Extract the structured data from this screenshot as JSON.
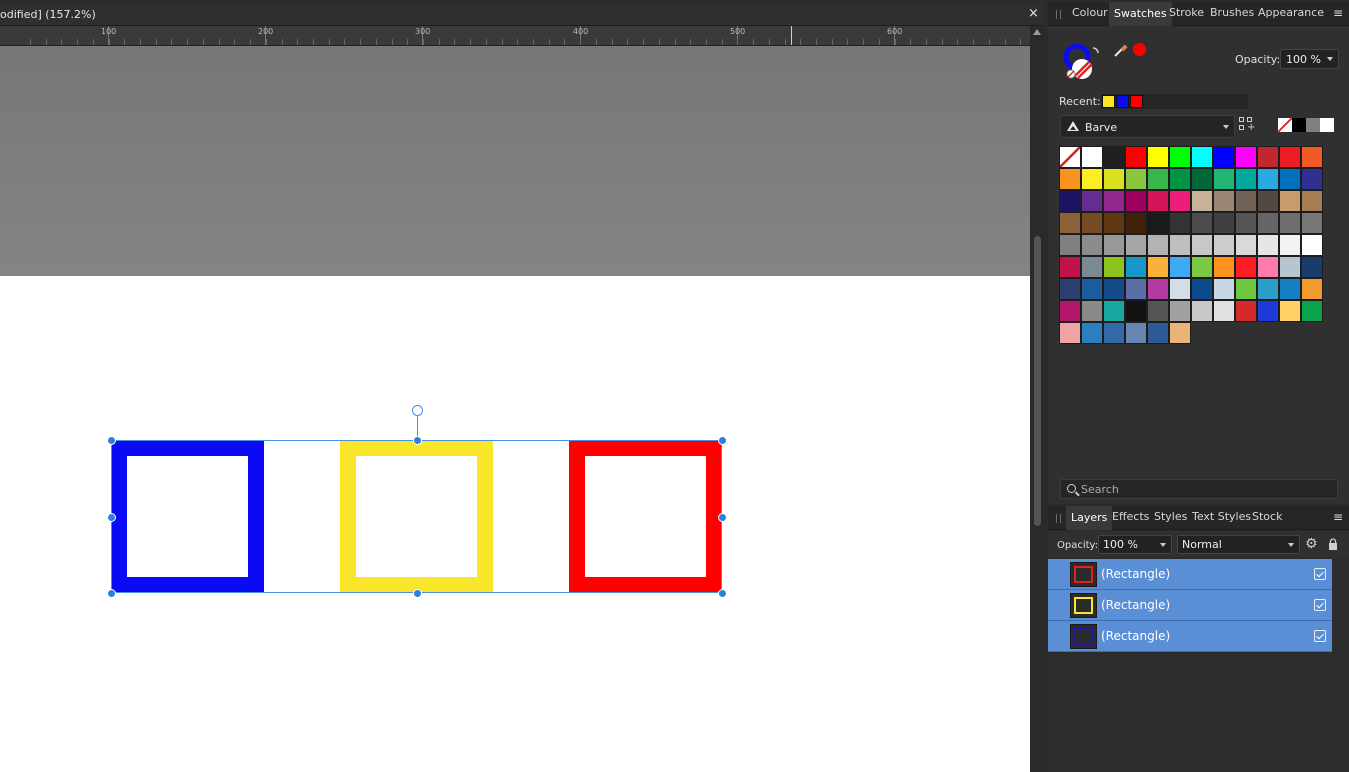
{
  "document": {
    "title": "odified] (157.2%)",
    "close_label": "×",
    "ruler_labels": [
      "100",
      "200",
      "300",
      "400",
      "500",
      "600"
    ]
  },
  "canvas": {
    "shapes": [
      {
        "name": "blue-rectangle",
        "stroke_color": "#0a0af5"
      },
      {
        "name": "yellow-rectangle",
        "stroke_color": "#f9e62a"
      },
      {
        "name": "red-rectangle",
        "stroke_color": "#ff0000"
      }
    ],
    "selection_color": "#4a8ee0"
  },
  "top_panel": {
    "tabs": [
      "Colour",
      "Swatches",
      "Stroke",
      "Brushes",
      "Appearance"
    ],
    "active_tab": "Swatches",
    "menu_icon": "≡",
    "opacity_label": "Opacity:",
    "opacity_value": "100 %",
    "fill_color": "#0a0af5",
    "picker_color": "#ff0000",
    "recent_label": "Recent:",
    "recent_colors": [
      "#f9e62a",
      "#0a0af5",
      "#ff0000"
    ],
    "palette_name": "Barve",
    "search_placeholder": "Search",
    "mini_swatches": [
      "none",
      "#000000",
      "#808080",
      "#ffffff"
    ],
    "swatches": [
      "none",
      "#ffffff",
      "#1f1f1f",
      "#ff0000",
      "#ffff00",
      "#00ff00",
      "#00ffff",
      "#0000ff",
      "#ff00ff",
      "#c1272d",
      "#ed1c24",
      "#f15a24",
      "#f7931e",
      "#fcee21",
      "#d9e021",
      "#8cc63f",
      "#39b54a",
      "#009245",
      "#006837",
      "#22b573",
      "#00a99d",
      "#29abe2",
      "#0071bc",
      "#2e3192",
      "#1b1464",
      "#662d91",
      "#93278f",
      "#9e005d",
      "#d4145a",
      "#ed1e79",
      "#c7b299",
      "#998675",
      "#736357",
      "#534741",
      "#c69c6d",
      "#a67c52",
      "#8c6239",
      "#754c24",
      "#603813",
      "#42210b",
      "#1a1a1a",
      "#333333",
      "#4d4d4d",
      "#404040",
      "#555555",
      "#666666",
      "#6e6e6e",
      "#777777",
      "#808080",
      "#8c8c8c",
      "#999999",
      "#a6a6a6",
      "#b3b3b3",
      "#bfbfbf",
      "#c7c7c7",
      "#cccccc",
      "#d9d9d9",
      "#e6e6e6",
      "#f2f2f2",
      "#ffffff",
      "#c1124a",
      "#7a8a94",
      "#8dc21f",
      "#1797c5",
      "#fbb03b",
      "#3fa9f5",
      "#7ac943",
      "#ff931e",
      "#ff1d25",
      "#ff7bac",
      "#b5c6d2",
      "#173d6b",
      "#2b3f6e",
      "#1a5c9e",
      "#164b8a",
      "#5b6ea6",
      "#b23aa0",
      "#d2dde8",
      "#0d4a8c",
      "#c9d6e3",
      "#6ec83f",
      "#2aa0c8",
      "#1580c4",
      "#f39a2c",
      "#b3166b",
      "#8a8a8a",
      "#1aa6a0",
      "#111111",
      "#555555",
      "#a0a0a0",
      "#c8c8c8",
      "#e0e0e0",
      "#d42a2a",
      "#1f3ad6",
      "#ffd166",
      "#09a44a",
      "#f2a3a3",
      "#2b7fc1",
      "#3468a6",
      "#6688b0",
      "#2e5a99",
      "#e8b576"
    ]
  },
  "layers_panel": {
    "tabs": [
      "Layers",
      "Effects",
      "Styles",
      "Text Styles",
      "Stock"
    ],
    "active_tab": "Layers",
    "menu_icon": "≡",
    "opacity_label": "Opacity:",
    "opacity_value": "100 %",
    "blend_mode": "Normal",
    "gear_icon": "⚙",
    "rows": [
      {
        "name": "(Rectangle)",
        "color": "#e02020"
      },
      {
        "name": "(Rectangle)",
        "color": "#f9e62a"
      },
      {
        "name": "(Rectangle)",
        "color": "#1a1aa8"
      }
    ]
  }
}
